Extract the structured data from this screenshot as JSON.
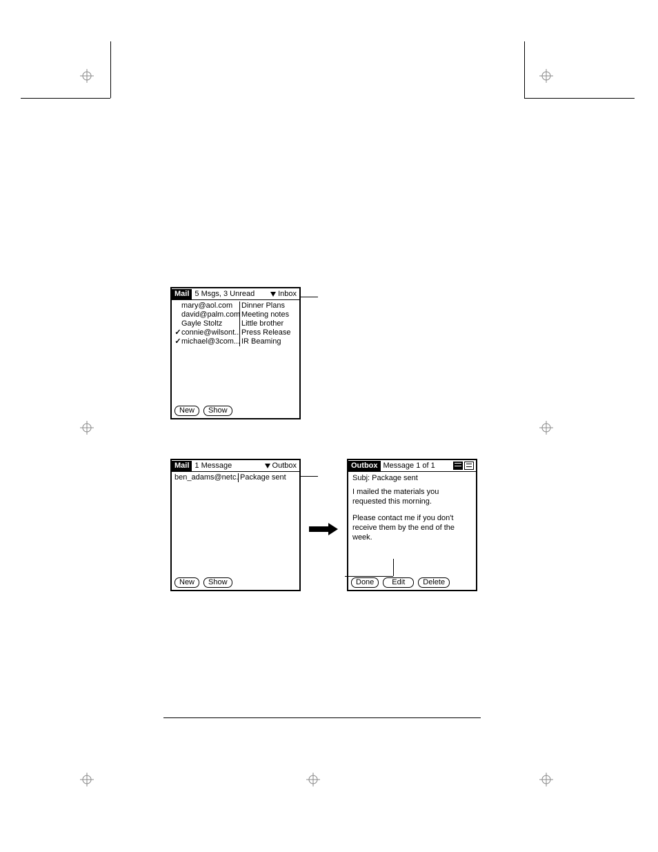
{
  "inbox": {
    "title": "Mail",
    "status": "5 Msgs, 3 Unread",
    "folder": "Inbox",
    "messages": [
      {
        "read": false,
        "from": "mary@aol.com",
        "subject": "Dinner Plans"
      },
      {
        "read": false,
        "from": "david@palm.com",
        "subject": "Meeting notes"
      },
      {
        "read": false,
        "from": "Gayle Stoltz",
        "subject": "Little brother"
      },
      {
        "read": true,
        "from": "connie@wilsont...",
        "subject": "Press Release"
      },
      {
        "read": true,
        "from": "michael@3com....",
        "subject": "IR Beaming"
      }
    ],
    "new_label": "New",
    "show_label": "Show"
  },
  "outbox": {
    "title": "Mail",
    "status": "1 Message",
    "folder": "Outbox",
    "messages": [
      {
        "from": "ben_adams@netc...",
        "subject": "Package sent"
      }
    ],
    "new_label": "New",
    "show_label": "Show"
  },
  "detail": {
    "title": "Outbox",
    "counter": "Message 1 of 1",
    "subject_label": "Subj:",
    "subject": "Package sent",
    "body_p1": "I mailed the materials you requested this morning.",
    "body_p2": "Please contact me if you don't receive them by the end of the week.",
    "done_label": "Done",
    "edit_label": "Edit",
    "delete_label": "Delete"
  }
}
